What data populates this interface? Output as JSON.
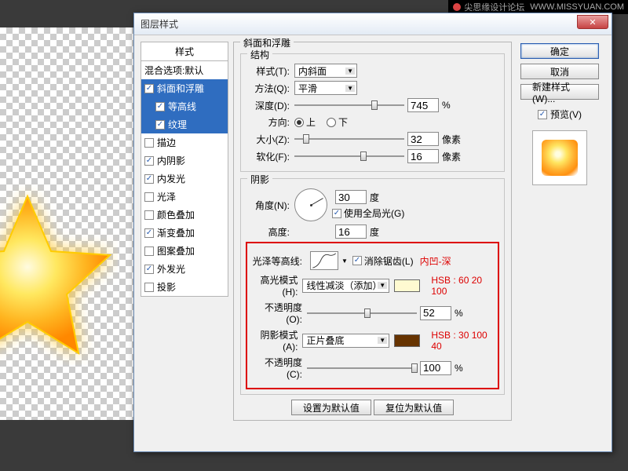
{
  "topbar": {
    "text": "尖思缘设计论坛",
    "url": "WWW.MISSYUAN.COM"
  },
  "dialog": {
    "title": "图层样式"
  },
  "styles": {
    "header": "样式",
    "blending": "混合选项:默认",
    "items": [
      {
        "label": "斜面和浮雕",
        "checked": true,
        "selected": true
      },
      {
        "label": "等高线",
        "checked": true,
        "selected": true,
        "indent": true
      },
      {
        "label": "纹理",
        "checked": true,
        "selected": true,
        "indent": true
      },
      {
        "label": "描边",
        "checked": false
      },
      {
        "label": "内阴影",
        "checked": true
      },
      {
        "label": "内发光",
        "checked": true
      },
      {
        "label": "光泽",
        "checked": false
      },
      {
        "label": "颜色叠加",
        "checked": false
      },
      {
        "label": "渐变叠加",
        "checked": true
      },
      {
        "label": "图案叠加",
        "checked": false
      },
      {
        "label": "外发光",
        "checked": true
      },
      {
        "label": "投影",
        "checked": false
      }
    ]
  },
  "bevel": {
    "group": "斜面和浮雕",
    "structure": {
      "title": "结构",
      "style_label": "样式(T):",
      "style_value": "内斜面",
      "tech_label": "方法(Q):",
      "tech_value": "平滑",
      "depth_label": "深度(D):",
      "depth_value": "745",
      "pct": "%",
      "dir_label": "方向:",
      "up": "上",
      "down": "下",
      "size_label": "大小(Z):",
      "size_value": "32",
      "px": "像素",
      "soften_label": "软化(F):",
      "soften_value": "16"
    },
    "shading": {
      "title": "阴影",
      "angle_label": "角度(N):",
      "angle_value": "30",
      "deg": "度",
      "global": "使用全局光(G)",
      "altitude_label": "高度:",
      "altitude_value": "16",
      "contour_label": "光泽等高线:",
      "antialias": "消除锯齿(L)",
      "annot_contour": "内凹-深",
      "hl_mode_label": "高光模式(H):",
      "hl_mode_value": "线性减淡（添加）",
      "hl_hsb": "HSB : 60 20 100",
      "hl_color": "#fffad1",
      "hl_opacity_label": "不透明度(O):",
      "hl_opacity_value": "52",
      "sh_mode_label": "阴影模式(A):",
      "sh_mode_value": "正片叠底",
      "sh_hsb": "HSB : 30 100 40",
      "sh_color": "#663300",
      "sh_opacity_label": "不透明度(C):",
      "sh_opacity_value": "100"
    }
  },
  "buttons": {
    "ok": "确定",
    "cancel": "取消",
    "new_style": "新建样式(W)...",
    "preview": "预览(V)",
    "defaults": "设置为默认值",
    "reset": "复位为默认值"
  }
}
